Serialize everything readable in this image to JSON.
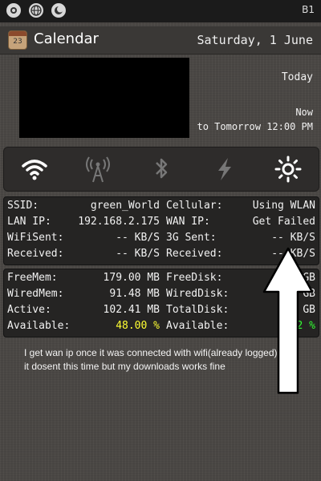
{
  "status_bar": {
    "right_text": "B1"
  },
  "header": {
    "app_title": "Calendar",
    "date": "Saturday, 1 June",
    "calendar_icon_day": "23"
  },
  "calendar": {
    "today_label": "Today",
    "now_label": "Now",
    "until_label": "to Tomorrow 12:00 PM"
  },
  "toggles": [
    {
      "icon": "wifi-icon",
      "active": true
    },
    {
      "icon": "cellular-tower-icon",
      "active": false
    },
    {
      "icon": "bluetooth-icon",
      "active": false
    },
    {
      "icon": "lightning-icon",
      "active": false
    },
    {
      "icon": "brightness-icon",
      "active": true
    }
  ],
  "network": {
    "rows": [
      {
        "label": "SSID:",
        "value": "green_World",
        "label2": "Cellular:",
        "value2": "Using WLAN"
      },
      {
        "label": "LAN IP:",
        "value": "192.168.2.175",
        "label2": "WAN IP:",
        "value2": "Get Failed"
      },
      {
        "label": "WiFiSent:",
        "value": "-- KB/S",
        "label2": "3G Sent:",
        "value2": "-- KB/S"
      },
      {
        "label": "Received:",
        "value": "-- KB/S",
        "label2": "Received:",
        "value2": "-- KB/S"
      }
    ]
  },
  "memory": {
    "rows": [
      {
        "label": "FreeMem:",
        "value": "179.00 MB",
        "label2": "FreeDisk:",
        "value2": "GB"
      },
      {
        "label": "WiredMem:",
        "value": "91.48 MB",
        "label2": "WiredDisk:",
        "value2": "GB"
      },
      {
        "label": "Active:",
        "value": "102.41 MB",
        "label2": "TotalDisk:",
        "value2": "GB"
      },
      {
        "label": "Available:",
        "value": "48.00 %",
        "label2": "Available:",
        "value2": "2 %"
      }
    ]
  },
  "note": "I get wan ip once it was connected with wifi(already logged), but it dosent this time but my downloads works fine",
  "colors": {
    "highlight_yellow": "#ffff33",
    "highlight_green": "#33ff33"
  }
}
